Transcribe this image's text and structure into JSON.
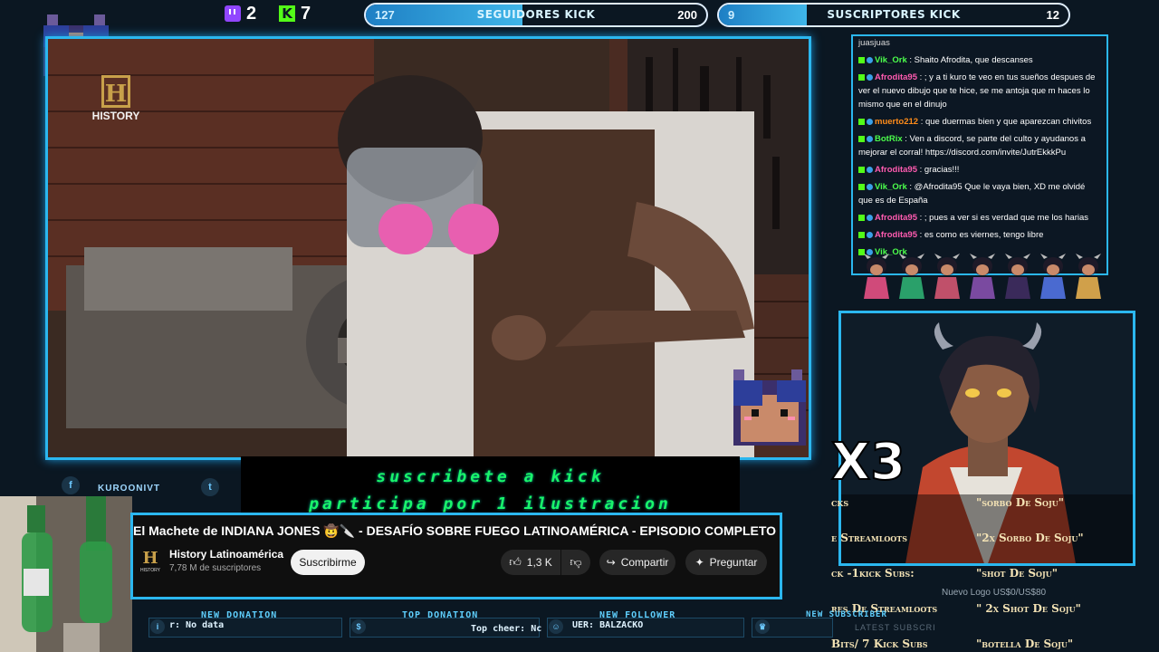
{
  "topbar": {
    "twitch_count": "2",
    "kick_count": "7",
    "followers_goal": {
      "label": "SEGUIDORES KICK",
      "min": "127",
      "max": "200",
      "progress": 0.46
    },
    "subs_goal": {
      "label": "SUSCRIPTORES KICK",
      "min": "9",
      "max": "12",
      "progress": 0.25
    }
  },
  "video": {
    "channel_logo_text": "HISTORY"
  },
  "chat": {
    "top_partial": "juasjuas",
    "messages": [
      {
        "user": "Vik_Ork",
        "color": "#4cff4c",
        "text": ": Shaito Afrodita, que descanses"
      },
      {
        "user": "Afrodita95",
        "color": "#ff5bb0",
        "text": ": ; y a ti kuro te veo en tus sueños despues de ver el nuevo dibujo que te hice, se me antoja que m haces lo mismo que en el dinujo"
      },
      {
        "user": "muerto212",
        "color": "#ff8c1a",
        "text": ": que duermas bien y que aparezcan chivitos"
      },
      {
        "user": "BotRix",
        "color": "#4cff4c",
        "text": ": Ven a discord, se parte del culto y ayudanos a mejorar el corral! https://discord.com/invite/JutrEkkkPu"
      },
      {
        "user": "Afrodita95",
        "color": "#ff5bb0",
        "text": ": gracias!!!"
      },
      {
        "user": "Vik_Ork",
        "color": "#4cff4c",
        "text": ": @Afrodita95 Que le vaya bien, XD me olvidé que es de España"
      },
      {
        "user": "Afrodita95",
        "color": "#ff5bb0",
        "text": ": ; pues a ver si es verdad que me los harias"
      },
      {
        "user": "Afrodita95",
        "color": "#ff5bb0",
        "text": ": es como es viernes, tengo libre"
      },
      {
        "user": "Vik_Ork",
        "color": "#4cff4c",
        "text": ""
      }
    ]
  },
  "avatar": {
    "multiplier": "X3"
  },
  "rewards": {
    "rows": [
      {
        "left": "cks",
        "right": "\"sorbo De Soju\""
      },
      {
        "left": "e Streamloots",
        "right": "\"2x Sorbo De Soju\""
      },
      {
        "left": "ck -1kick Subs:",
        "right": "\"shot De Soju\""
      },
      {
        "left": "res De Streamloots",
        "right": "\" 2x Shot De Soju\""
      },
      {
        "left": "Bits/ 7 Kick Subs",
        "right": "\"botella De Soju\""
      }
    ],
    "overlay_goal_label": "Nuevo Logo",
    "overlay_goal_value": "US$0/US$80",
    "overlay_latest_sub": "LATEST SUBSCRI"
  },
  "banner": {
    "line1": "suscribete a kick",
    "line2": "participa por 1 ilustracion"
  },
  "social": {
    "facebook_handle": "KUROONIVT"
  },
  "youtube": {
    "title": "El Machete de INDIANA JONES 🤠🔪 - DESAFÍO SOBRE FUEGO LATINOAMÉRICA - EPISODIO COMPLETO",
    "channel_name": "History Latinoamérica",
    "subscribers": "7,78 M de suscriptores",
    "subscribe_label": "Suscribirme",
    "likes": "1,3 K",
    "share_label": "Compartir",
    "ask_label": "Preguntar"
  },
  "alerts": {
    "new_donation_title": "NEW DONATION",
    "new_donation_value": "r: No data",
    "top_donation_title": "TOP DONATION",
    "top_cheer_value": "Top cheer: Nc",
    "new_follower_title": "NEW FOLLOWER",
    "new_follower_value": "UER: BALZACKO",
    "new_sub_title": "NEW SUBSCRIBER"
  }
}
